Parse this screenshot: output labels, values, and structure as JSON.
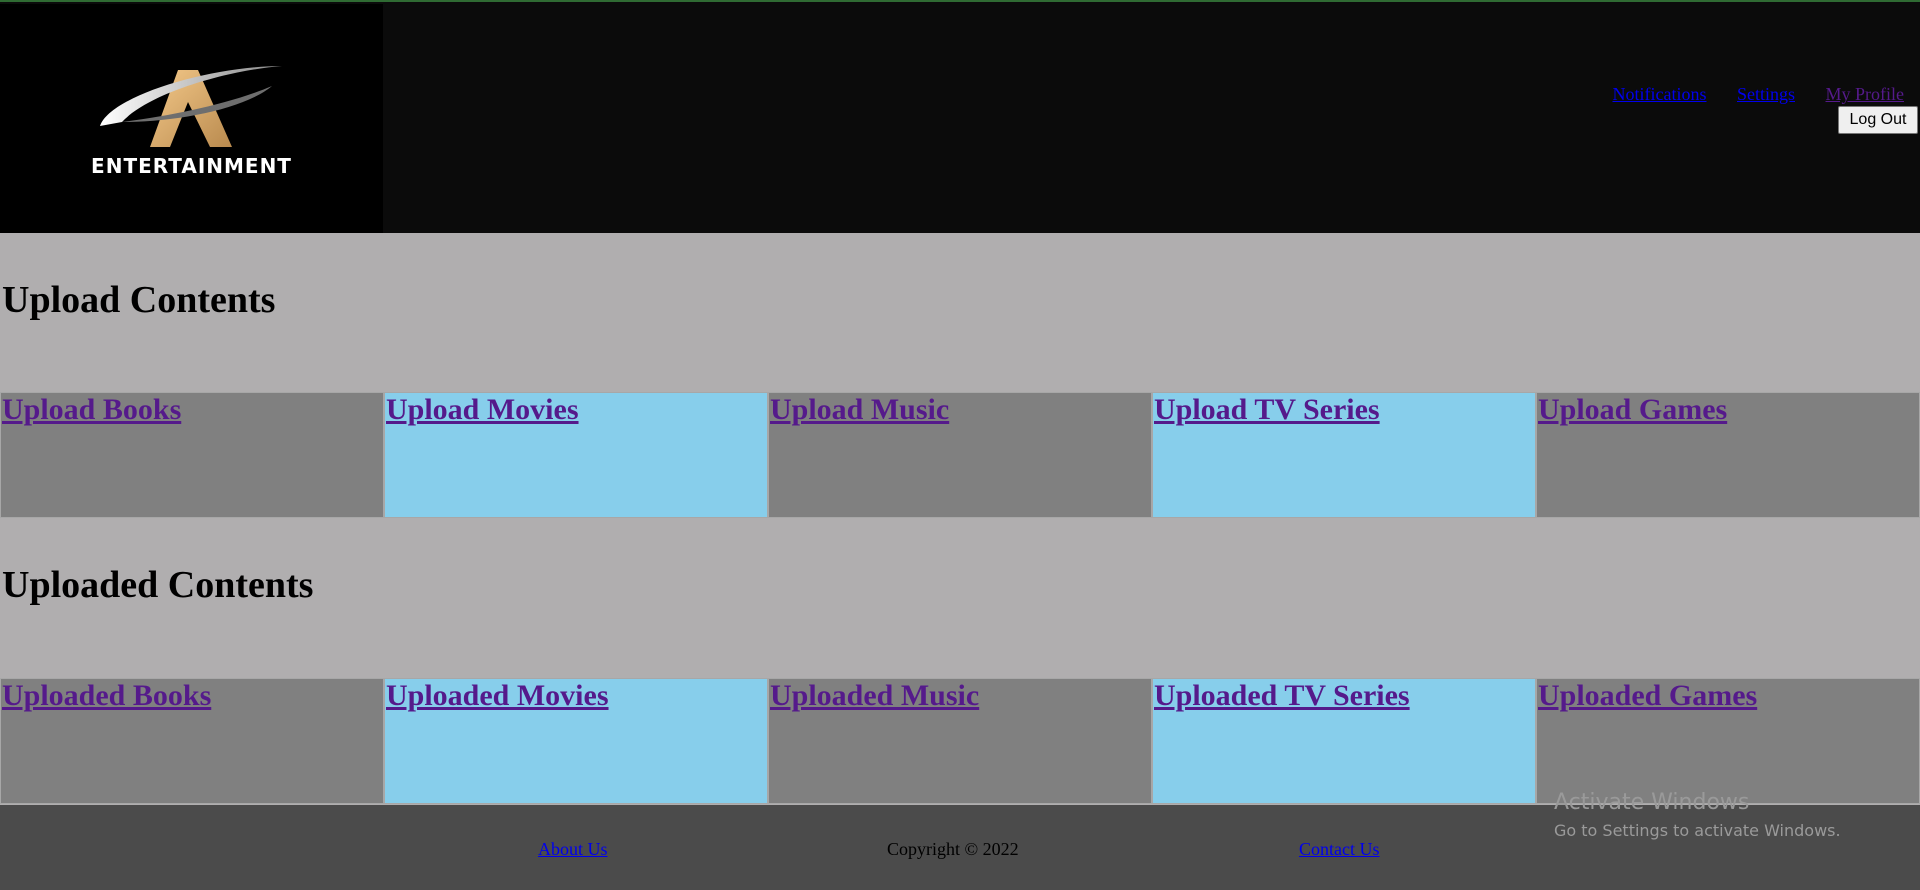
{
  "header": {
    "logo_text": "ENTERTAINMENT",
    "nav": [
      "Notifications",
      "Settings",
      "My Profile"
    ],
    "logout_label": "Log Out"
  },
  "upload": {
    "title": "Upload Contents",
    "tiles": [
      "Upload Books",
      "Upload Movies",
      "Upload Music",
      "Upload TV Series",
      "Upload Games"
    ]
  },
  "uploaded": {
    "title": "Uploaded Contents",
    "tiles": [
      "Uploaded Books",
      "Uploaded Movies",
      "Uploaded Music",
      "Uploaded TV Series",
      "Uploaded Games"
    ]
  },
  "footer": {
    "about": "About Us",
    "copyright": "Copyright © 2022",
    "contact": "Contact Us"
  },
  "watermark": {
    "line1": "Activate Windows",
    "line2": "Go to Settings to activate Windows."
  },
  "colors": {
    "page_bg": "#b0aeaf",
    "header_bg": "#0b0b0b",
    "tile_gray": "#808080",
    "tile_blue": "#87ceeb",
    "link": "#551a8b",
    "footer_bg": "#4b4b4b"
  }
}
